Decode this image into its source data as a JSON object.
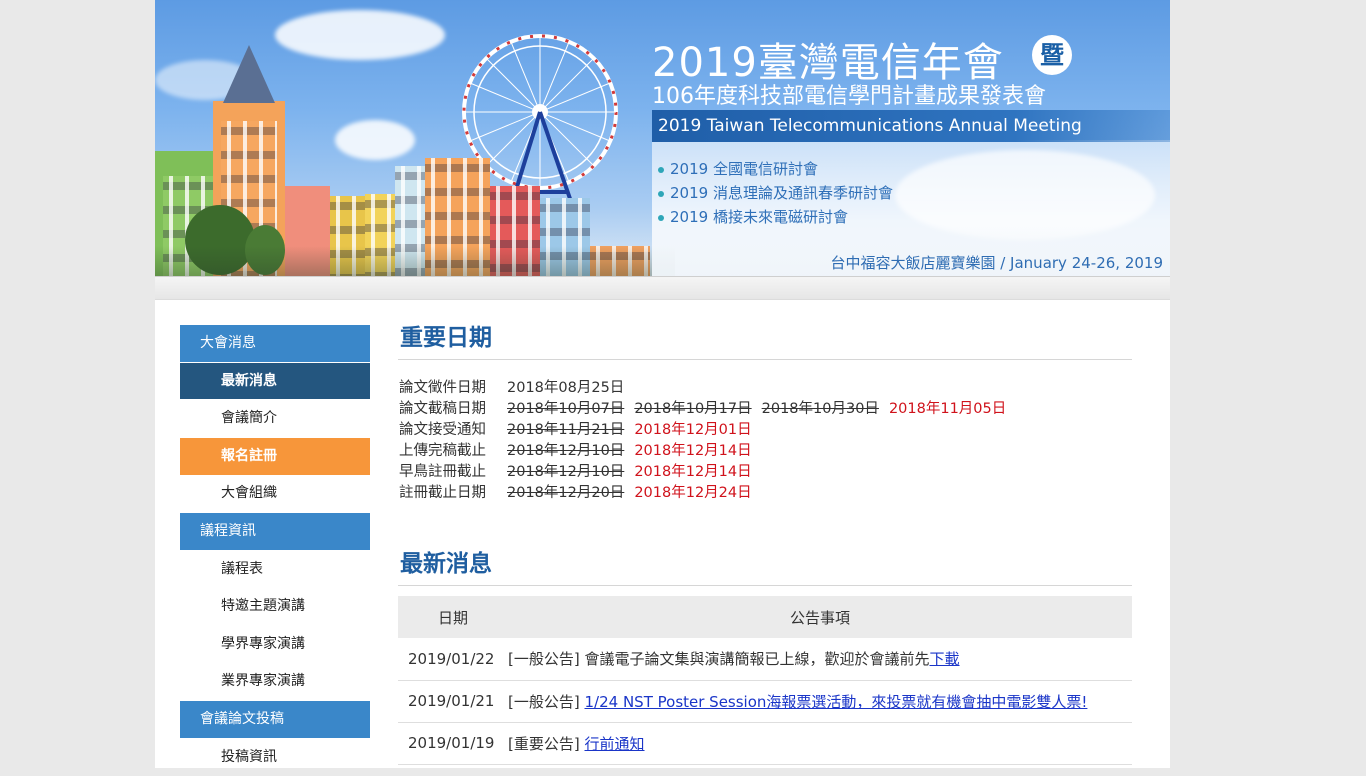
{
  "banner": {
    "title_main": "2019臺灣電信年會",
    "title_badge": "暨",
    "title_sub": "106年度科技部電信學門計畫成果發表會",
    "title_en": "2019 Taiwan Telecommunications Annual Meeting",
    "subconferences": [
      "2019 全國電信研討會",
      "2019 消息理論及通訊春季研討會",
      "2019 橋接未來電磁研討會"
    ],
    "venue": "台中福容大飯店麗寶樂園  /  January 24-26, 2019"
  },
  "sidebar": {
    "items": [
      {
        "label": "大會消息",
        "type": "section"
      },
      {
        "label": "最新消息",
        "type": "active"
      },
      {
        "label": "會議簡介",
        "type": "link"
      },
      {
        "label": "報名註冊",
        "type": "highlight"
      },
      {
        "label": "大會組織",
        "type": "link"
      },
      {
        "label": "議程資訊",
        "type": "section"
      },
      {
        "label": "議程表",
        "type": "link"
      },
      {
        "label": "特邀主題演講",
        "type": "link"
      },
      {
        "label": "學界專家演講",
        "type": "link"
      },
      {
        "label": "業界專家演講",
        "type": "link"
      },
      {
        "label": "會議論文投稿",
        "type": "section"
      },
      {
        "label": "投稿資訊",
        "type": "link"
      }
    ]
  },
  "important_dates": {
    "title": "重要日期",
    "rows": [
      {
        "label": "論文徵件日期",
        "struck": [],
        "current": "2018年08月25日",
        "current_plain": true
      },
      {
        "label": "論文截稿日期",
        "struck": [
          "2018年10月07日",
          "2018年10月17日",
          "2018年10月30日"
        ],
        "current": "2018年11月05日"
      },
      {
        "label": "論文接受通知",
        "struck": [
          "2018年11月21日"
        ],
        "current": "2018年12月01日"
      },
      {
        "label": "上傳完稿截止",
        "struck": [
          "2018年12月10日"
        ],
        "current": "2018年12月14日"
      },
      {
        "label": "早鳥註冊截止",
        "struck": [
          "2018年12月10日"
        ],
        "current": "2018年12月14日"
      },
      {
        "label": "註冊截止日期",
        "struck": [
          "2018年12月20日"
        ],
        "current": "2018年12月24日"
      }
    ]
  },
  "news": {
    "title": "最新消息",
    "headers": {
      "date": "日期",
      "notice": "公告事項"
    },
    "rows": [
      {
        "date": "2019/01/22",
        "tag": "[一般公告]",
        "text": " 會議電子論文集與演講簡報已上線，歡迎於會議前先",
        "link": "下載"
      },
      {
        "date": "2019/01/21",
        "tag": "[一般公告]",
        "text": " ",
        "link": "1/24 NST Poster Session海報票選活動，來投票就有機會抽中電影雙人票!"
      },
      {
        "date": "2019/01/19",
        "tag": "[重要公告]",
        "text": " ",
        "link": "行前通知"
      }
    ]
  }
}
